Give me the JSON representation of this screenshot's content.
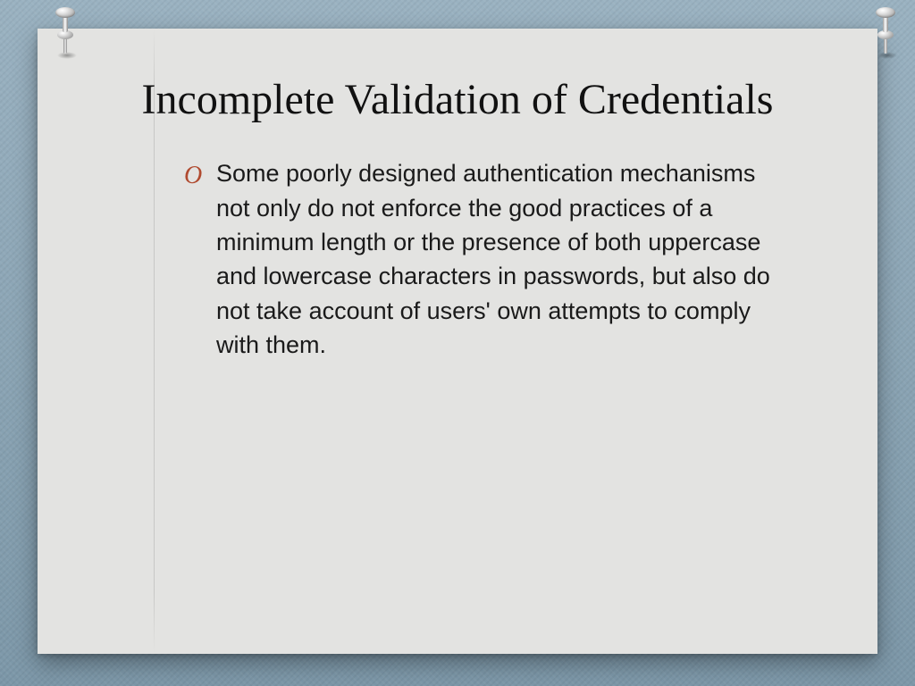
{
  "slide": {
    "title": "Incomplete Validation of Credentials",
    "bullet_marker": "O",
    "bullets": [
      "Some poorly designed authentication mechanisms not only do not enforce the good practices of a minimum length or the presence of both uppercase and lowercase characters in passwords, but also do not take account of users' own attempts to comply with them."
    ]
  },
  "colors": {
    "background": "#8aa4b5",
    "card": "#e3e3e1",
    "marker": "#b04a2f",
    "text": "#1a1a1a"
  }
}
